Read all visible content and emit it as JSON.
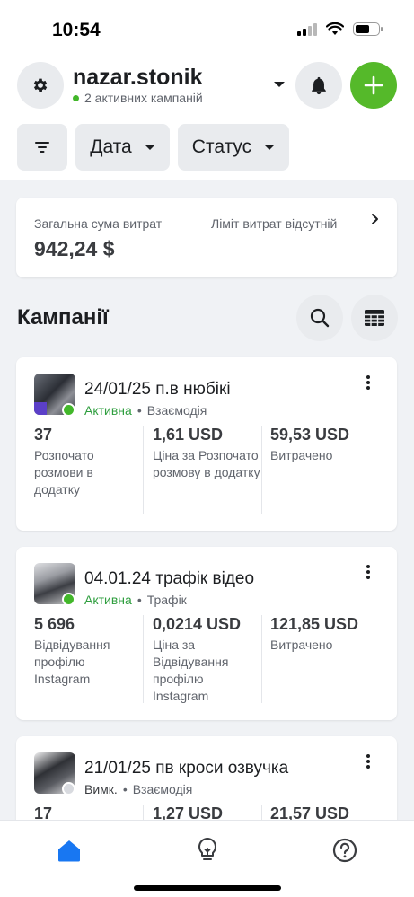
{
  "status_bar": {
    "time": "10:54"
  },
  "account": {
    "name": "nazar.stonik",
    "subtitle": "2 активних кампаній"
  },
  "filters": {
    "date_label": "Дата",
    "status_label": "Статус"
  },
  "spend": {
    "label": "Загальна сума витрат",
    "value": "942,24 $",
    "limit_text": "Ліміт витрат відсутній"
  },
  "section": {
    "title": "Кампанії"
  },
  "campaigns": [
    {
      "name": "24/01/25 п.в нюбікі",
      "status": "Активна",
      "status_color": "#42b72a",
      "type": "Взаємодія",
      "metrics": [
        {
          "value": "37",
          "label": "Розпочато розмови в додатку"
        },
        {
          "value": "1,61 USD",
          "label": "Ціна за Розпочато розмову в додатку"
        },
        {
          "value": "59,53 USD",
          "label": "Витрачено"
        }
      ]
    },
    {
      "name": "04.01.24 трафік відео",
      "status": "Активна",
      "status_color": "#42b72a",
      "type": "Трафік",
      "metrics": [
        {
          "value": "5 696",
          "label": "Відвідування профілю Instagram"
        },
        {
          "value": "0,0214 USD",
          "label": "Ціна за Відвідування профілю Instagram"
        },
        {
          "value": "121,85 USD",
          "label": "Витрачено"
        }
      ]
    },
    {
      "name": "21/01/25 пв кроси озвучка",
      "status": "Вимк.",
      "status_color": "#d8dadf",
      "type": "Взаємодія",
      "metrics": [
        {
          "value": "17",
          "label": ""
        },
        {
          "value": "1,27 USD",
          "label": ""
        },
        {
          "value": "21,57 USD",
          "label": ""
        }
      ]
    }
  ],
  "colors": {
    "accent_green": "#55b92a",
    "active_green": "#42b72a",
    "nav_blue": "#1877f2"
  },
  "icons": [
    "gear-icon",
    "caret-down-icon",
    "bell-icon",
    "plus-icon",
    "filter-icon",
    "chevron-right-icon",
    "search-icon",
    "table-icon",
    "more-icon",
    "home-icon",
    "lightbulb-icon",
    "help-icon"
  ]
}
